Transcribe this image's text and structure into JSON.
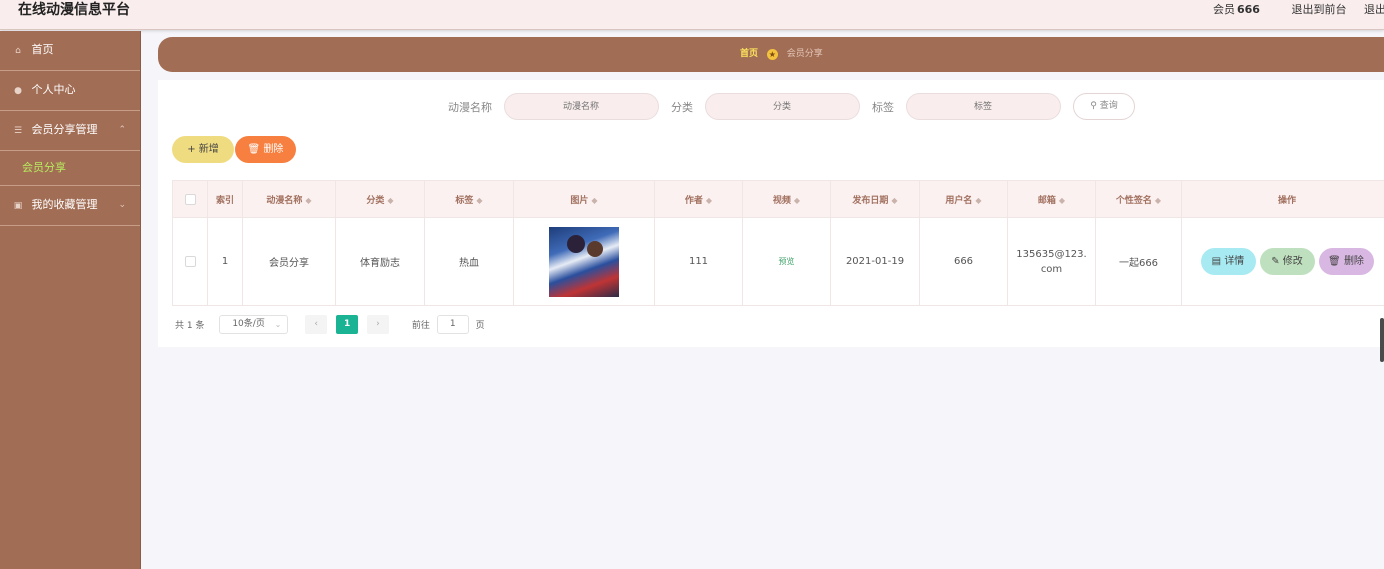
{
  "header": {
    "title": "在线动漫信息平台",
    "member_label": "会员",
    "username": "666",
    "back_front": "退出到前台",
    "logout": "退出登录"
  },
  "sidebar": {
    "items": [
      {
        "label": "首页",
        "icon": "home-icon"
      },
      {
        "label": "个人中心",
        "icon": "user-icon"
      },
      {
        "label": "会员分享管理",
        "icon": "list-icon",
        "sub": [
          {
            "label": "会员分享"
          }
        ]
      },
      {
        "label": "我的收藏管理",
        "icon": "bookmark-icon"
      }
    ]
  },
  "breadcrumb": {
    "home": "首页",
    "current": "会员分享"
  },
  "search": {
    "name_label": "动漫名称",
    "name_placeholder": "动漫名称",
    "category_label": "分类",
    "category_placeholder": "分类",
    "tag_label": "标签",
    "tag_placeholder": "标签",
    "query_label": "查询"
  },
  "actions": {
    "add_label": "新增",
    "delete_label": "删除"
  },
  "table": {
    "headers": [
      "索引",
      "动漫名称",
      "分类",
      "标签",
      "图片",
      "作者",
      "视频",
      "发布日期",
      "用户名",
      "邮箱",
      "个性签名",
      "操作"
    ],
    "rows": [
      {
        "index": "1",
        "name": "会员分享",
        "category": "体育励志",
        "tag": "热血",
        "author": "111",
        "video": "预览",
        "date": "2021-01-19",
        "username": "666",
        "email": "135635@123.com",
        "signature": "一起666",
        "ops": {
          "detail": "详情",
          "edit": "修改",
          "delete": "删除"
        }
      }
    ]
  },
  "pagination": {
    "total": "共 1 条",
    "page_size": "10条/页",
    "current_page": "1",
    "goto_label": "前往",
    "goto_value": "1",
    "page_unit": "页"
  },
  "colors": {
    "sidebar": "#a26d55",
    "accent_green": "#1ab394",
    "add_button": "#f0dc80",
    "delete_button": "#f78040"
  }
}
